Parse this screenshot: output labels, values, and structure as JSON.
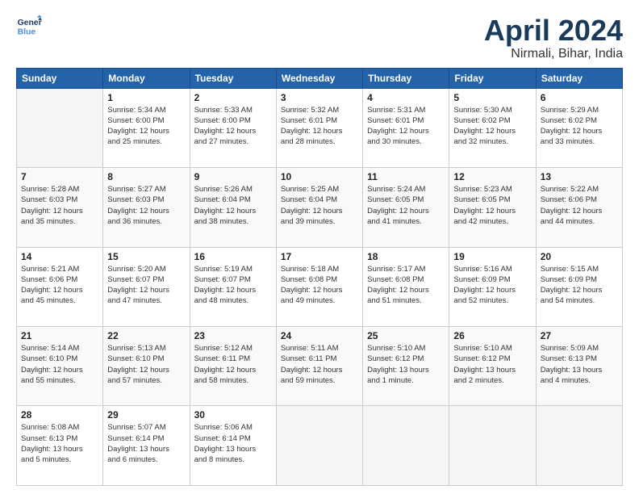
{
  "logo": {
    "line1": "General",
    "line2": "Blue"
  },
  "title": "April 2024",
  "subtitle": "Nirmali, Bihar, India",
  "header_days": [
    "Sunday",
    "Monday",
    "Tuesday",
    "Wednesday",
    "Thursday",
    "Friday",
    "Saturday"
  ],
  "weeks": [
    [
      {
        "day": "",
        "info": ""
      },
      {
        "day": "1",
        "info": "Sunrise: 5:34 AM\nSunset: 6:00 PM\nDaylight: 12 hours\nand 25 minutes."
      },
      {
        "day": "2",
        "info": "Sunrise: 5:33 AM\nSunset: 6:00 PM\nDaylight: 12 hours\nand 27 minutes."
      },
      {
        "day": "3",
        "info": "Sunrise: 5:32 AM\nSunset: 6:01 PM\nDaylight: 12 hours\nand 28 minutes."
      },
      {
        "day": "4",
        "info": "Sunrise: 5:31 AM\nSunset: 6:01 PM\nDaylight: 12 hours\nand 30 minutes."
      },
      {
        "day": "5",
        "info": "Sunrise: 5:30 AM\nSunset: 6:02 PM\nDaylight: 12 hours\nand 32 minutes."
      },
      {
        "day": "6",
        "info": "Sunrise: 5:29 AM\nSunset: 6:02 PM\nDaylight: 12 hours\nand 33 minutes."
      }
    ],
    [
      {
        "day": "7",
        "info": "Sunrise: 5:28 AM\nSunset: 6:03 PM\nDaylight: 12 hours\nand 35 minutes."
      },
      {
        "day": "8",
        "info": "Sunrise: 5:27 AM\nSunset: 6:03 PM\nDaylight: 12 hours\nand 36 minutes."
      },
      {
        "day": "9",
        "info": "Sunrise: 5:26 AM\nSunset: 6:04 PM\nDaylight: 12 hours\nand 38 minutes."
      },
      {
        "day": "10",
        "info": "Sunrise: 5:25 AM\nSunset: 6:04 PM\nDaylight: 12 hours\nand 39 minutes."
      },
      {
        "day": "11",
        "info": "Sunrise: 5:24 AM\nSunset: 6:05 PM\nDaylight: 12 hours\nand 41 minutes."
      },
      {
        "day": "12",
        "info": "Sunrise: 5:23 AM\nSunset: 6:05 PM\nDaylight: 12 hours\nand 42 minutes."
      },
      {
        "day": "13",
        "info": "Sunrise: 5:22 AM\nSunset: 6:06 PM\nDaylight: 12 hours\nand 44 minutes."
      }
    ],
    [
      {
        "day": "14",
        "info": "Sunrise: 5:21 AM\nSunset: 6:06 PM\nDaylight: 12 hours\nand 45 minutes."
      },
      {
        "day": "15",
        "info": "Sunrise: 5:20 AM\nSunset: 6:07 PM\nDaylight: 12 hours\nand 47 minutes."
      },
      {
        "day": "16",
        "info": "Sunrise: 5:19 AM\nSunset: 6:07 PM\nDaylight: 12 hours\nand 48 minutes."
      },
      {
        "day": "17",
        "info": "Sunrise: 5:18 AM\nSunset: 6:08 PM\nDaylight: 12 hours\nand 49 minutes."
      },
      {
        "day": "18",
        "info": "Sunrise: 5:17 AM\nSunset: 6:08 PM\nDaylight: 12 hours\nand 51 minutes."
      },
      {
        "day": "19",
        "info": "Sunrise: 5:16 AM\nSunset: 6:09 PM\nDaylight: 12 hours\nand 52 minutes."
      },
      {
        "day": "20",
        "info": "Sunrise: 5:15 AM\nSunset: 6:09 PM\nDaylight: 12 hours\nand 54 minutes."
      }
    ],
    [
      {
        "day": "21",
        "info": "Sunrise: 5:14 AM\nSunset: 6:10 PM\nDaylight: 12 hours\nand 55 minutes."
      },
      {
        "day": "22",
        "info": "Sunrise: 5:13 AM\nSunset: 6:10 PM\nDaylight: 12 hours\nand 57 minutes."
      },
      {
        "day": "23",
        "info": "Sunrise: 5:12 AM\nSunset: 6:11 PM\nDaylight: 12 hours\nand 58 minutes."
      },
      {
        "day": "24",
        "info": "Sunrise: 5:11 AM\nSunset: 6:11 PM\nDaylight: 12 hours\nand 59 minutes."
      },
      {
        "day": "25",
        "info": "Sunrise: 5:10 AM\nSunset: 6:12 PM\nDaylight: 13 hours\nand 1 minute."
      },
      {
        "day": "26",
        "info": "Sunrise: 5:10 AM\nSunset: 6:12 PM\nDaylight: 13 hours\nand 2 minutes."
      },
      {
        "day": "27",
        "info": "Sunrise: 5:09 AM\nSunset: 6:13 PM\nDaylight: 13 hours\nand 4 minutes."
      }
    ],
    [
      {
        "day": "28",
        "info": "Sunrise: 5:08 AM\nSunset: 6:13 PM\nDaylight: 13 hours\nand 5 minutes."
      },
      {
        "day": "29",
        "info": "Sunrise: 5:07 AM\nSunset: 6:14 PM\nDaylight: 13 hours\nand 6 minutes."
      },
      {
        "day": "30",
        "info": "Sunrise: 5:06 AM\nSunset: 6:14 PM\nDaylight: 13 hours\nand 8 minutes."
      },
      {
        "day": "",
        "info": ""
      },
      {
        "day": "",
        "info": ""
      },
      {
        "day": "",
        "info": ""
      },
      {
        "day": "",
        "info": ""
      }
    ]
  ]
}
